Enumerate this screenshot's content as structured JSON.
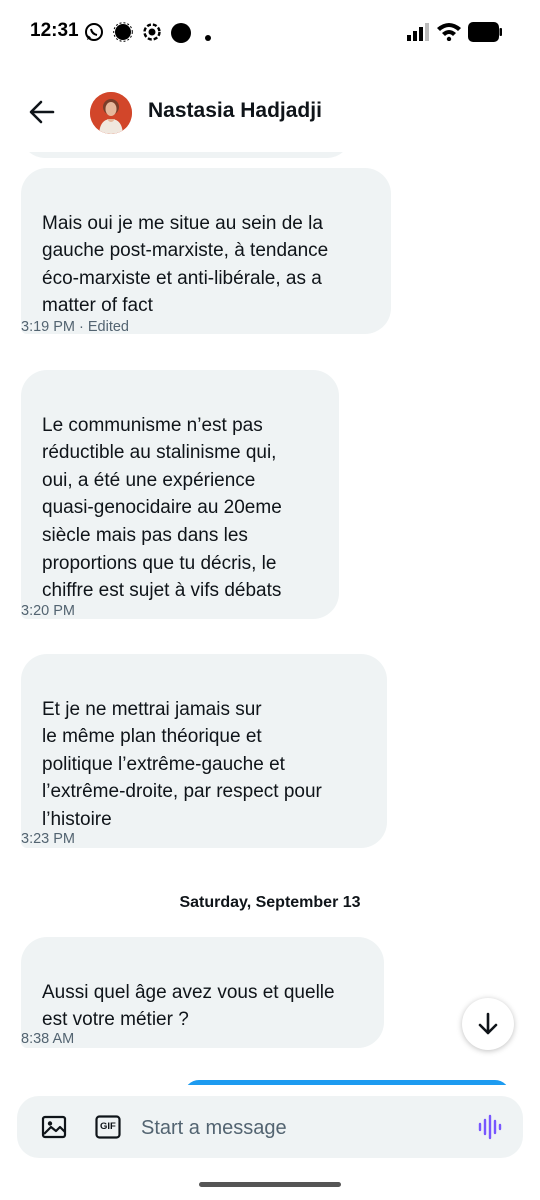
{
  "status_bar": {
    "time": "12:31",
    "icons": [
      "whatsapp-icon",
      "signal-icon",
      "app-icon",
      "dot-icon",
      "small-dot-icon",
      "cell-signal-icon",
      "wifi-icon",
      "battery-icon"
    ]
  },
  "header": {
    "back_icon": "arrow-left-icon",
    "name": "Nastasia Hadjadji"
  },
  "messages": [
    {
      "text": "Mais oui je me situe au sein de la\ngauche post-marxiste, à tendance\néco-marxiste et anti-libérale, as a\nmatter of fact",
      "meta": "3:19 PM · Edited"
    },
    {
      "text": "Le communisme n’est pas\nréductible au stalinisme qui,\noui, a été une expérience\nquasi-genocidaire au 20eme\nsiècle mais pas dans les\nproportions que tu décris, le\nchiffre est sujet à vifs débats",
      "meta": "3:20 PM"
    },
    {
      "text": "Et je ne mettrai jamais sur\nle même plan théorique et\npolitique l’extrême-gauche et\nl’extrême-droite, par respect pour\nl’histoire",
      "meta": "3:23 PM"
    },
    {
      "text": "Aussi quel âge avez vous et quelle\nest votre métier ?",
      "meta": "8:38 AM"
    }
  ],
  "date_separator": "Saturday, September 13",
  "composer": {
    "placeholder": "Start a message",
    "icons": [
      "image-icon",
      "gif-icon",
      "voice-icon"
    ],
    "gif_label": "GIF"
  },
  "colors": {
    "bubble_received": "#eff3f4",
    "bubble_sent": "#1d9bf0",
    "text_primary": "#0f1419",
    "text_secondary": "#536471",
    "voice_accent": "#7856ff"
  }
}
